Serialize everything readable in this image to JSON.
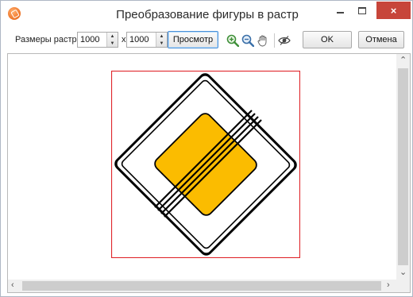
{
  "window": {
    "title": "Преобразование фигуры в растр",
    "controls": {
      "minimize": "minimize-icon",
      "maximize": "maximize-icon",
      "close": "×"
    }
  },
  "toolbar": {
    "raster_size_label": "Размеры растра:",
    "width_value": "1000",
    "height_value": "1000",
    "times_sign": "x",
    "preview_label": "Просмотр",
    "tools": [
      "zoom-in-icon",
      "zoom-out-icon",
      "hand-pan-icon",
      "show-hide-icon"
    ],
    "ok_label": "OK",
    "cancel_label": "Отмена"
  },
  "preview": {
    "image": "priority-road-end-sign",
    "frame_color": "#e0262b",
    "sign_fill": "#fbbc00",
    "scrollbars": {
      "vertical": true,
      "horizontal": true
    }
  }
}
